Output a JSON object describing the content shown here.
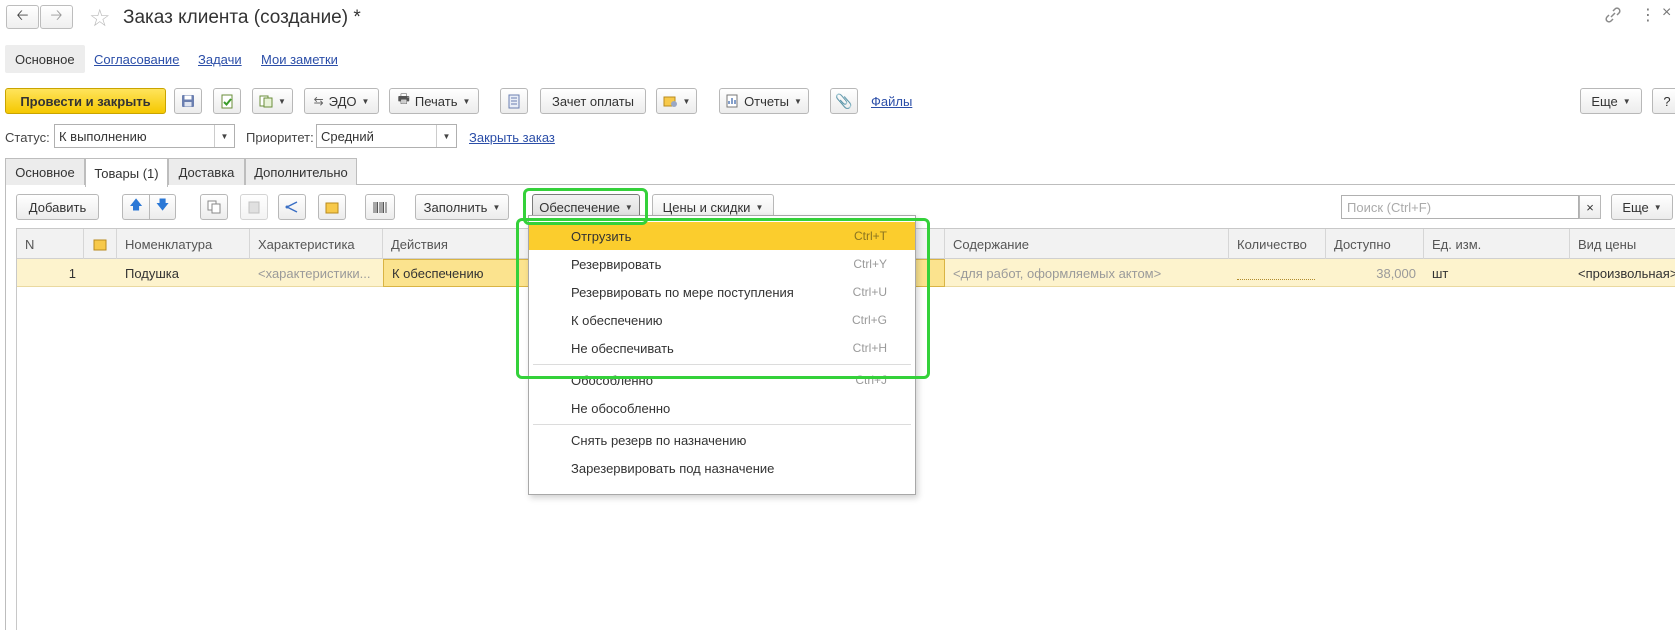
{
  "window": {
    "title": "Заказ клиента (создание) *",
    "back_icon": "arrow-left-icon",
    "forward_icon": "arrow-right-icon",
    "favorite_icon": "star-icon",
    "link_icon": "link-icon",
    "more_icon": "vertical-dots-icon",
    "close_label": "×"
  },
  "sections": {
    "main": "Основное",
    "approval": "Согласование",
    "tasks": "Задачи",
    "notes": "Мои заметки"
  },
  "toolbar": {
    "post_close": "Провести и закрыть",
    "edo": "ЭДО",
    "print": "Печать",
    "payment_offset": "Зачет оплаты",
    "reports": "Отчеты",
    "files": "Файлы",
    "more": "Еще",
    "help": "?"
  },
  "status": {
    "label": "Статус:",
    "value": "К выполнению",
    "priority_label": "Приоритет:",
    "priority_value": "Средний",
    "close_order": "Закрыть заказ"
  },
  "tabs": [
    "Основное",
    "Товары (1)",
    "Доставка",
    "Дополнительно"
  ],
  "goods_toolbar": {
    "add": "Добавить",
    "fill": "Заполнить",
    "provision": "Обеспечение",
    "prices": "Цены и скидки",
    "search_placeholder": "Поиск (Ctrl+F)",
    "clear": "×",
    "more": "Еще"
  },
  "table": {
    "headers": {
      "n": "N",
      "nomenclature": "Номенклатура",
      "characteristic": "Характеристика",
      "actions": "Действия",
      "content": "Содержание",
      "quantity": "Количество",
      "available": "Доступно",
      "unit": "Ед. изм.",
      "price_type": "Вид цены"
    },
    "rows": [
      {
        "n": "1",
        "nomenclature": "Подушка",
        "characteristic": "<характеристики...",
        "actions": "К обеспечению",
        "content": "<для работ, оформляемых актом>",
        "quantity": "",
        "available": "38,000",
        "unit": "шт",
        "price_type": "<произвольная>"
      }
    ]
  },
  "menu": {
    "items": [
      {
        "label": "Отгрузить",
        "shortcut": "Ctrl+T",
        "highlighted": true
      },
      {
        "label": "Резервировать",
        "shortcut": "Ctrl+Y"
      },
      {
        "label": "Резервировать по мере поступления",
        "shortcut": "Ctrl+U"
      },
      {
        "label": "К обеспечению",
        "shortcut": "Ctrl+G"
      },
      {
        "label": "Не обеспечивать",
        "shortcut": "Ctrl+H"
      },
      {
        "label": "Обособленно",
        "shortcut": "Ctrl+J"
      },
      {
        "label": "Не обособленно",
        "shortcut": ""
      },
      {
        "label": "Снять резерв по назначению",
        "shortcut": ""
      },
      {
        "label": "Зарезервировать под назначение",
        "shortcut": ""
      }
    ]
  },
  "colors": {
    "accent_yellow": "#fbcd2d",
    "row_highlight": "#fdf3cd",
    "annotation_green": "#34d13a",
    "link_blue": "#2b4ea8"
  }
}
